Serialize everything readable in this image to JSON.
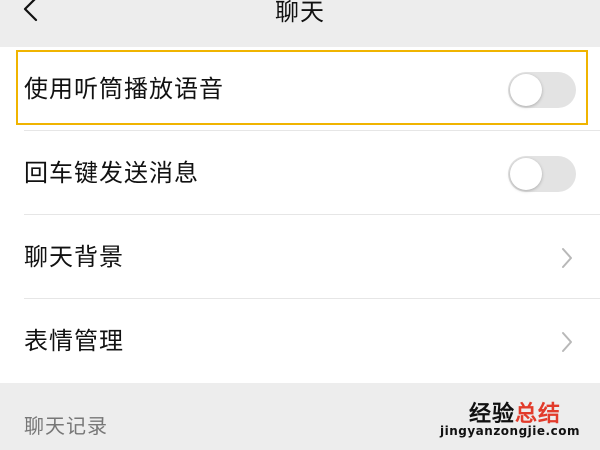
{
  "header": {
    "back_icon": "chevron-left-icon",
    "title": "聊天"
  },
  "settings": [
    {
      "label": "使用听筒播放语音",
      "control": "toggle",
      "enabled": false
    },
    {
      "label": "回车键发送消息",
      "control": "toggle",
      "enabled": false
    },
    {
      "label": "聊天背景",
      "control": "chevron",
      "icon": "chevron-right-icon"
    },
    {
      "label": "表情管理",
      "control": "chevron",
      "icon": "chevron-right-icon"
    }
  ],
  "section": {
    "title": "聊天记录"
  },
  "watermark": {
    "main_text": "经验",
    "accent_text": "总结",
    "url": "jingyanzongjie.com"
  },
  "colors": {
    "page_background": "#ededed",
    "row_background": "#ffffff",
    "divider": "#e6e6e6",
    "highlight": "#f0b400",
    "toggle_off_track": "#e3e3e3",
    "toggle_knob": "#ffffff",
    "secondary_text": "#777777",
    "watermark_accent": "#e23b2b"
  }
}
